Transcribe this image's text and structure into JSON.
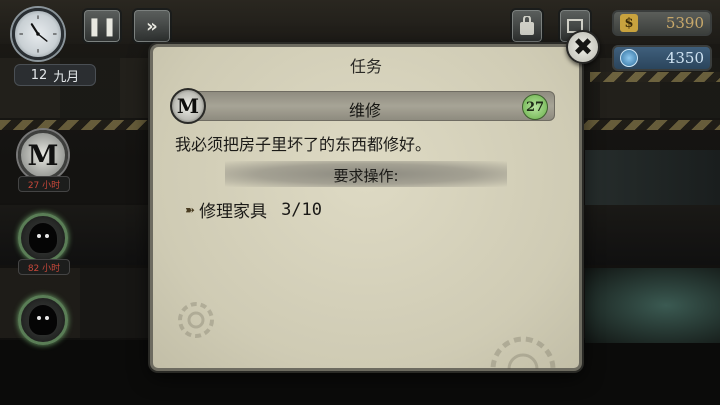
{
  "hud": {
    "date_day": "12",
    "date_month": "九月",
    "money": "5390",
    "energy": "4350",
    "money_icon": "$"
  },
  "characters": [
    {
      "icon": "M",
      "time_tag": "27 小时"
    },
    {
      "icon": "shadow",
      "time_tag": "82 小时"
    },
    {
      "icon": "shadow",
      "time_tag": ""
    }
  ],
  "dialog": {
    "title": "任务",
    "task_name": "维修",
    "task_icon": "M",
    "task_level": "27",
    "description": "我必须把房子里坏了的东西都修好。",
    "requirements_label": "要求操作:",
    "requirements": [
      {
        "label": "修理家具",
        "progress": "3/10",
        "current": 3,
        "total": 10
      }
    ],
    "close_symbol": "✖"
  },
  "colors": {
    "panel": "#d7d3bd",
    "task_bar": "#a7a496",
    "level_badge": "#7fbf62",
    "money_text": "#c8a86a",
    "energy_bg": "#3f5f7c"
  },
  "icons": [
    "clock-icon",
    "pause-icon",
    "fast-forward-icon",
    "bag-icon",
    "shop-icon",
    "dollar-icon",
    "energy-orb-icon",
    "close-icon",
    "arrow-bullet-icon",
    "gear-decoration-icon"
  ]
}
